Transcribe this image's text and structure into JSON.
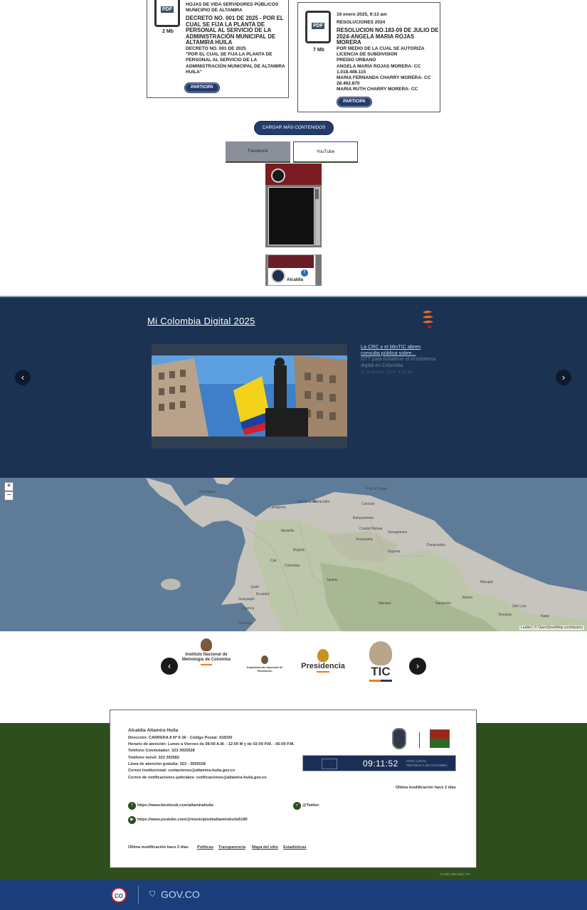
{
  "doc_cards": [
    {
      "size": "2 Mb",
      "small_title_lines": [
        "HOJAS DE VIDA SERVIDORES PÚBLICOS",
        "MUNICIPIO DE ALTAMIRA"
      ],
      "big_lines": [
        "DECRETO NO. 001 DE 2025 - POR EL",
        "CUAL SE FIJA LA PLANTA DE",
        "PERSONAL AL SERVICIO DE LA",
        "ADMINISTRACIÓN MUNICIPAL DE",
        "ALTAMIRA HUILA"
      ],
      "body_lines": [
        "DECRETO NO. 001 DE 2025",
        "\"POR EL CUAL SE FIJA LA PLANTA DE",
        "PERSONAL AL SERVICIO DE LA",
        "ADMINISTRACIÓN MUNICIPAL DE ALTAMIRA",
        "HUILA\""
      ],
      "button": "PARTICIPA"
    },
    {
      "size": "7 Mb",
      "date": "16 enero 2025, 9:13 am",
      "category": "RESOLUCIONES 2024",
      "big_lines": [
        "RESOLUCION No.183-09 DE JULIO DE",
        "2024-ANGELA MARIA ROJAS MORERA"
      ],
      "body_lines": [
        "POR MEDIO DE LA CUAL SE AUTORIZA",
        "LICENCIA DE SUBDIVISION",
        "PREDIO URBANO",
        "ANGELA MARIA ROJAS MORERA- CC",
        "1.018.408.115",
        "MARIA FERNANDA CHARRY MORERA- CC",
        "28.462.870",
        "MARIA RUTH CHARRY MORERA- CC"
      ],
      "button": "PARTICIPA"
    }
  ],
  "load_more": "CARGAR MÁS CONTENIDOS",
  "social_tabs": [
    "Facebook",
    "YouTube"
  ],
  "fb_widget": {
    "page_name": "Alcaldía"
  },
  "mcd": {
    "title": "Mi Colombia Digital 2025",
    "prev": "‹",
    "next": "›",
    "side_title": "La CRC y el MinTIC abren consulta pública sobre...",
    "side_desc": "OTT para fortalecer el ecosistema digital en Colombia",
    "side_date": "11 diciembre 2024, 4:58 pm"
  },
  "map": {
    "zoom_in": "+",
    "zoom_out": "−",
    "attribution": "Leaflet | © OpenStreetMap contributors",
    "labels": [
      "Nicaragua",
      "Caracas",
      "Maracaibo",
      "Barquisimeto",
      "Cartagena",
      "Barranquilla",
      "Medellín",
      "Bogotá",
      "Colombia",
      "Venezuela",
      "Guyana",
      "Georgetown",
      "Paramaribo",
      "Quito",
      "Ecuador",
      "Cali",
      "Ciudad Bolívar",
      "Manaus",
      "Belém",
      "São Luís",
      "Teresina",
      "Natal",
      "Chiclayo",
      "Iquitos",
      "Macapá",
      "Santarém",
      "Port of Spain",
      "Guayaquil",
      "Cuenca"
    ]
  },
  "logos": [
    {
      "name": "Instituto Nacional de Metrología de Colombia"
    },
    {
      "name": "Departamento Nacional de Planeación"
    },
    {
      "name": "Presidencia"
    },
    {
      "name": "TIC"
    }
  ],
  "footer": {
    "entity": "Alcaldía Altamira Huila",
    "address": "Dirección: CARRERA 8 Nº 6-36 - Código Postal: 416030",
    "hours": "Horario de atención: Lunes a Viernes de 08:00 A.M. - 12:00 M y de 02:00 P.M. - 06:00 P.M.",
    "phone": "Teléfono Conmutador: 323 3925528",
    "mobile": "Teléfono móvil: 323 393582",
    "free_line": "Línea de atención gratuita: 323 - 3925528",
    "email": "Correo Institucional: contactenos@altamira-huila.gov.co",
    "judicial_email": "Correo de notificaciones judiciales: notificaciones@altamira-huila.gov.co",
    "last_mod_right": "Última modificación hace 2 días",
    "facebook_url": "https://www.facebook.com/altamirahuila",
    "twitter": "@Twitter",
    "youtube_url": "https://www.youtube.com/@municipiodealtamirahuila5180",
    "last_mod_bottom": "Última modificación hace 2 días",
    "links": [
      "Políticas",
      "Transparencia",
      "Mapa del sitio",
      "Estadísticas"
    ],
    "clock_time": "09:11:52",
    "clock_label_1": "HORA LEGAL",
    "clock_label_2": "REPÚBLICA DE COLOMBIA",
    "credit": "Creado Municipio TIC"
  },
  "gov": {
    "co_badge": "CO",
    "gov_label": "GOV.CO"
  }
}
